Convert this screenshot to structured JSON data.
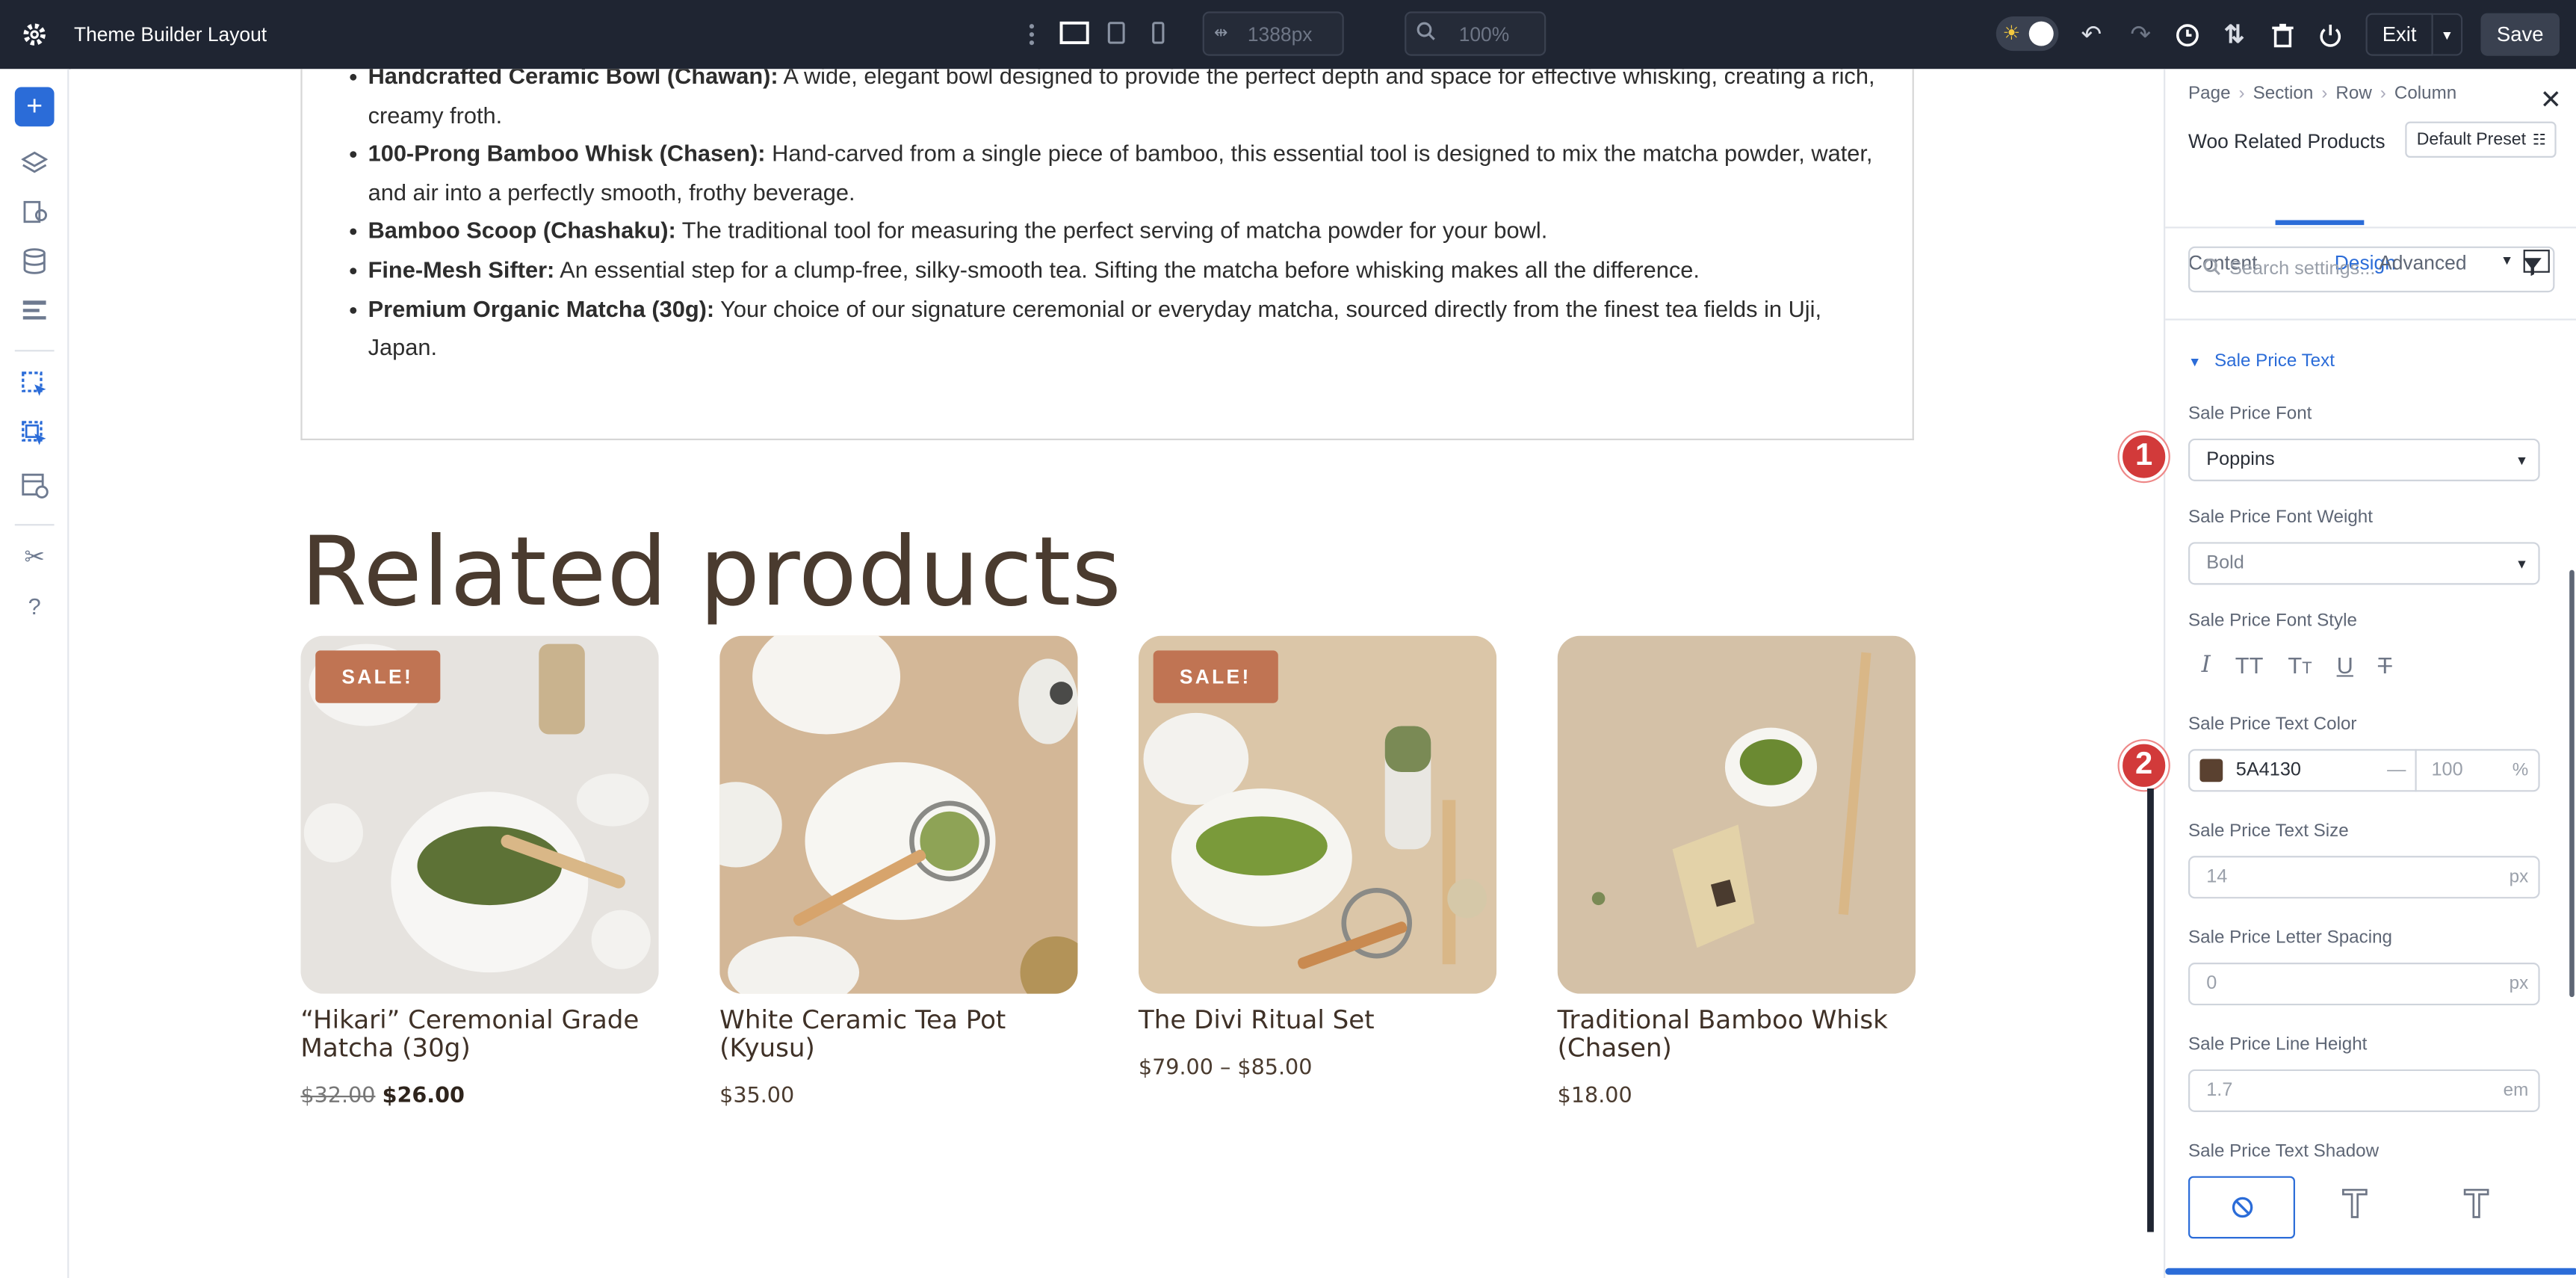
{
  "topbar": {
    "title": "Theme Builder Layout",
    "width_value": "1388px",
    "zoom_value": "100%",
    "exit_label": "Exit",
    "save_label": "Save"
  },
  "leftbar": {
    "icons": [
      "plus-icon",
      "layers-icon",
      "pages-icon",
      "database-icon",
      "list-icon",
      "pointer-icon",
      "pointer-multi-icon",
      "layout-icon",
      "tools-icon",
      "help-icon"
    ]
  },
  "description": {
    "items": [
      {
        "bold": "Handcrafted Ceramic Bowl (Chawan):",
        "text": " A wide, elegant bowl designed to provide the perfect depth and space for effective whisking, creating a rich, creamy froth."
      },
      {
        "bold": "100-Prong Bamboo Whisk (Chasen):",
        "text": " Hand-carved from a single piece of bamboo, this essential tool is designed to mix the matcha powder, water, and air into a perfectly smooth, frothy beverage."
      },
      {
        "bold": "Bamboo Scoop (Chashaku):",
        "text": " The traditional tool for measuring the perfect serving of matcha powder for your bowl."
      },
      {
        "bold": "Fine-Mesh Sifter:",
        "text": " An essential step for a clump-free, silky-smooth tea. Sifting the matcha before whisking makes all the difference."
      },
      {
        "bold": "Premium Organic Matcha (30g):",
        "text": " Your choice of our signature ceremonial or everyday matcha, sourced directly from the finest tea fields in Uji, Japan."
      }
    ]
  },
  "related": {
    "title": "Related products",
    "products": [
      {
        "name": "“Hikari” Ceremonial Grade Matcha (30g)",
        "sale": "SALE!",
        "old_price": "$32.00",
        "price": "$26.00"
      },
      {
        "name": "White Ceramic Tea Pot (Kyusu)",
        "sale": "",
        "old_price": "",
        "price": "$35.00"
      },
      {
        "name": "The Divi Ritual Set",
        "sale": "SALE!",
        "old_price": "",
        "price": "$79.00 – $85.00"
      },
      {
        "name": "Traditional Bamboo Whisk (Chasen)",
        "sale": "",
        "old_price": "",
        "price": "$18.00"
      }
    ]
  },
  "panel": {
    "breadcrumb": [
      "Page",
      "Section",
      "Row",
      "Column"
    ],
    "module_title": "Woo Related Products",
    "preset_label": "Default Preset",
    "tabs": [
      "Content",
      "Design",
      "Advanced"
    ],
    "search_placeholder": "Search settings...",
    "group_title": "Sale Price Text",
    "font_label": "Sale Price Font",
    "font_value": "Poppins",
    "weight_label": "Sale Price Font Weight",
    "weight_value": "Bold",
    "style_label": "Sale Price Font Style",
    "color_label": "Sale Price Text Color",
    "color_value": "5A4130",
    "color_hex": "#5A4130",
    "opacity_value": "100",
    "opacity_unit": "%",
    "dash": "—",
    "size_label": "Sale Price Text Size",
    "size_value": "14",
    "size_unit": "px",
    "spacing_label": "Sale Price Letter Spacing",
    "spacing_value": "0",
    "spacing_unit": "px",
    "lineheight_label": "Sale Price Line Height",
    "lineheight_value": "1.7",
    "lineheight_unit": "em",
    "shadow_label": "Sale Price Text Shadow",
    "markers": [
      "1",
      "2"
    ]
  },
  "colors": {
    "accent": "#2b6cd8",
    "topbar": "#1f2532",
    "heading": "#4a3b2f",
    "sale_badge": "#c07453",
    "marker": "#d23a3a"
  }
}
